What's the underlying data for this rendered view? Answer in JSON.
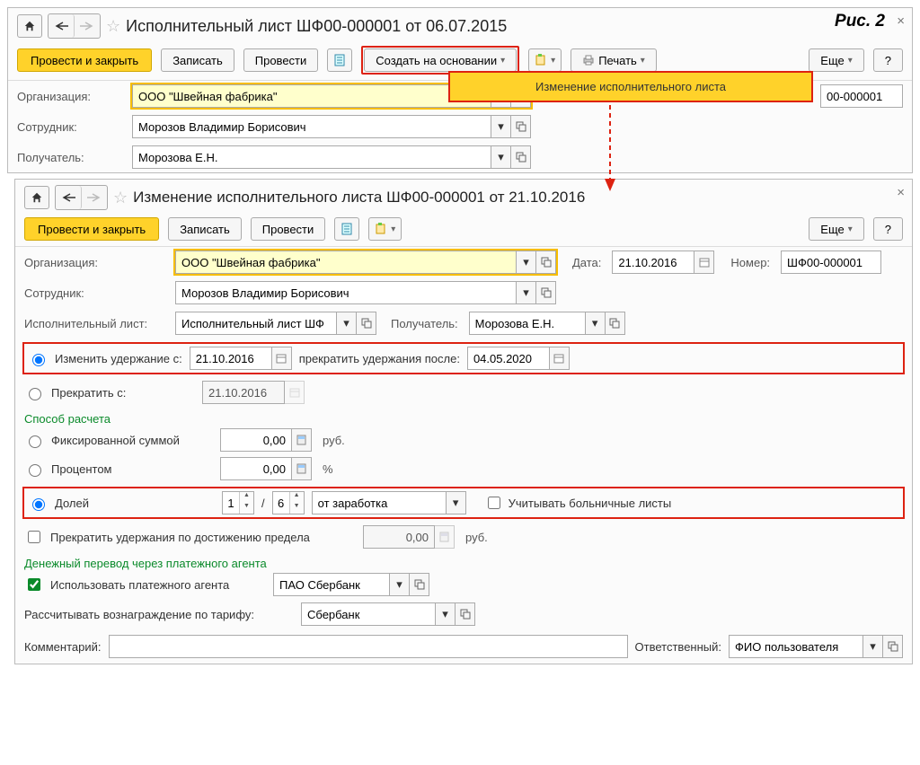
{
  "figure_label": "Рис. 2",
  "win1": {
    "title": "Исполнительный лист ШФ00-000001 от 06.07.2015",
    "tb": {
      "apply_close": "Провести и закрыть",
      "save": "Записать",
      "apply": "Провести",
      "create_based": "Создать на основании",
      "print": "Печать",
      "more": "Еще",
      "help": "?"
    },
    "dropdown_item": "Изменение исполнительного листа",
    "org_label": "Организация:",
    "org_value": "ООО \"Швейная фабрика\"",
    "number_tail": "00-000001",
    "emp_label": "Сотрудник:",
    "emp_value": "Морозов Владимир Борисович",
    "recip_label": "Получатель:",
    "recip_value": "Морозова Е.Н."
  },
  "win2": {
    "title": "Изменение исполнительного листа ШФ00-000001 от 21.10.2016",
    "tb": {
      "apply_close": "Провести и закрыть",
      "save": "Записать",
      "apply": "Провести",
      "more": "Еще",
      "help": "?"
    },
    "org_label": "Организация:",
    "org_value": "ООО \"Швейная фабрика\"",
    "date_label": "Дата:",
    "date_value": "21.10.2016",
    "num_label": "Номер:",
    "num_value": "ШФ00-000001",
    "emp_label": "Сотрудник:",
    "emp_value": "Морозов Владимир Борисович",
    "doc_label": "Исполнительный лист:",
    "doc_value": "Исполнительный лист ШФ",
    "recip_label": "Получатель:",
    "recip_value": "Морозова Е.Н.",
    "change_from_label": "Изменить удержание с:",
    "change_from_value": "21.10.2016",
    "stop_after_label": "прекратить удержания после:",
    "stop_after_value": "04.05.2020",
    "stop_from_label": "Прекратить с:",
    "stop_from_value": "21.10.2016",
    "calc_section": "Способ расчета",
    "fixed_label": "Фиксированной суммой",
    "fixed_value": "0,00",
    "rub": "руб.",
    "percent_label": "Процентом",
    "percent_value": "0,00",
    "percent_unit": "%",
    "share_label": "Долей",
    "share_num": "1",
    "share_den": "6",
    "share_slash": "/",
    "share_base": "от заработка",
    "sick_label": "Учитывать больничные листы",
    "limit_label": "Прекратить удержания по достижению предела",
    "limit_value": "0,00",
    "transfer_section": "Денежный перевод через платежного агента",
    "use_agent_label": "Использовать платежного агента",
    "agent_value": "ПАО Сбербанк",
    "fee_label": "Рассчитывать вознаграждение по тарифу:",
    "fee_value": "Сбербанк",
    "comment_label": "Комментарий:",
    "resp_label": "Ответственный:",
    "resp_value": "ФИО пользователя"
  }
}
